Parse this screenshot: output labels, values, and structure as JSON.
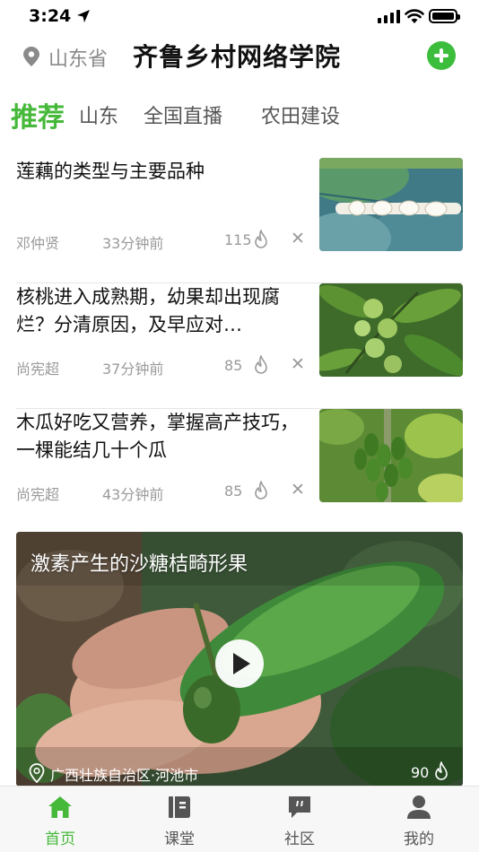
{
  "status_bar": {
    "time": "3:24"
  },
  "header": {
    "location": "山东省",
    "title": "齐鲁乡村网络学院",
    "add_icon": "plus-circle-icon"
  },
  "tabs": [
    {
      "label": "推荐",
      "active": true
    },
    {
      "label": "山东",
      "active": false
    },
    {
      "label": "全国直播",
      "active": false
    },
    {
      "label": "农田建设",
      "active": false
    }
  ],
  "articles": [
    {
      "title": "莲藕的类型与主要品种",
      "author": "邓仲贤",
      "time": "33分钟前",
      "views": "115"
    },
    {
      "title": "核桃进入成熟期，幼果却出现腐烂？分清原因，及早应对…",
      "author": "尚宪超",
      "time": "37分钟前",
      "views": "85"
    },
    {
      "title": "木瓜好吃又营养，掌握高产技巧，一棵能结几十个瓜",
      "author": "尚宪超",
      "time": "43分钟前",
      "views": "85"
    }
  ],
  "video": {
    "title": "激素产生的沙糖桔畸形果",
    "location": "广西壮族自治区·河池市",
    "views": "90"
  },
  "tabbar": [
    {
      "label": "首页",
      "icon": "home-icon",
      "active": true
    },
    {
      "label": "课堂",
      "icon": "book-icon",
      "active": false
    },
    {
      "label": "社区",
      "icon": "chat-quote-icon",
      "active": false
    },
    {
      "label": "我的",
      "icon": "person-icon",
      "active": false
    }
  ],
  "colors": {
    "accent": "#46b83a",
    "add_button": "#3cbd3c",
    "muted_text": "#9a9a9a"
  }
}
